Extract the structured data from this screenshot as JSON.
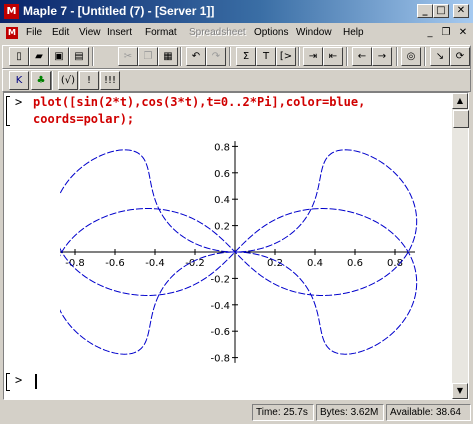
{
  "window": {
    "app_icon": "maple-leaf-icon",
    "title": "Maple 7 - [Untitled (7) - [Server 1]]",
    "controls": {
      "minimize": "_",
      "maximize": "□",
      "close": "✕"
    }
  },
  "menubar": {
    "items": [
      {
        "label": "File"
      },
      {
        "label": "Edit"
      },
      {
        "label": "View"
      },
      {
        "label": "Insert"
      },
      {
        "label": "Format"
      },
      {
        "label": "Spreadsheet",
        "disabled": true
      },
      {
        "label": "Options"
      },
      {
        "label": "Window"
      },
      {
        "label": "Help"
      }
    ],
    "doc_controls": {
      "minimize": "_",
      "restore": "❐",
      "close": "✕"
    }
  },
  "toolbar": {
    "buttons": [
      {
        "icon": "new-document-icon",
        "glyph": "▯"
      },
      {
        "icon": "open-folder-icon",
        "glyph": "▰"
      },
      {
        "icon": "save-icon",
        "glyph": "▣"
      },
      {
        "icon": "print-icon",
        "glyph": "▤"
      },
      {
        "icon": "cut-icon",
        "glyph": "✂",
        "disabled": true
      },
      {
        "icon": "copy-icon",
        "glyph": "❐",
        "disabled": true
      },
      {
        "icon": "paste-icon",
        "glyph": "▦"
      },
      {
        "icon": "undo-icon",
        "glyph": "↶"
      },
      {
        "icon": "redo-icon",
        "glyph": "↷",
        "disabled": true
      },
      {
        "icon": "sigma-icon",
        "glyph": "Σ"
      },
      {
        "icon": "text-mode-icon",
        "glyph": "T"
      },
      {
        "icon": "insert-prompt-icon",
        "glyph": "[>"
      },
      {
        "icon": "indent-icon",
        "glyph": "⇥"
      },
      {
        "icon": "outdent-icon",
        "glyph": "⇤"
      },
      {
        "icon": "back-icon",
        "glyph": "←"
      },
      {
        "icon": "forward-icon",
        "glyph": "→"
      },
      {
        "icon": "stop-icon",
        "glyph": "◎"
      },
      {
        "icon": "zoom-icon",
        "glyph": "↘"
      },
      {
        "icon": "restart-icon",
        "glyph": "⟳"
      }
    ]
  },
  "context_toolbar": {
    "buttons": [
      {
        "icon": "maple-input-icon",
        "glyph": "K"
      },
      {
        "icon": "leaf-icon",
        "glyph": "♣"
      },
      {
        "icon": "expression-icon",
        "glyph": "(√)"
      },
      {
        "icon": "execute-icon",
        "glyph": "!"
      },
      {
        "icon": "execute-all-icon",
        "glyph": "!!!"
      }
    ]
  },
  "worksheet": {
    "prompt": ">",
    "command_line1": "plot([sin(2*t),cos(3*t),t=0..2*Pi],color=blue,",
    "command_line2": "coords=polar);",
    "empty_prompt": ">"
  },
  "chart_data": {
    "type": "line",
    "title": "",
    "xlabel": "",
    "ylabel": "",
    "coords": "polar",
    "curve": {
      "r": "sin(2*t)",
      "theta": "cos(3*t)",
      "t_range": [
        0,
        6.283185
      ]
    },
    "color": "#0000cc",
    "xlim": [
      -0.9,
      0.9
    ],
    "ylim": [
      -0.84,
      0.84
    ],
    "x_ticks": [
      "-0.8",
      "-0.6",
      "-0.4",
      "-0.2",
      "0.2",
      "0.4",
      "0.6",
      "0.8"
    ],
    "y_ticks": [
      "0.8",
      "0.6",
      "0.4",
      "0.2",
      "-0.2",
      "-0.4",
      "-0.6",
      "-0.8"
    ],
    "x_tick_values": [
      -0.8,
      -0.6,
      -0.4,
      -0.2,
      0.2,
      0.4,
      0.6,
      0.8
    ],
    "y_tick_values": [
      0.8,
      0.6,
      0.4,
      0.2,
      -0.2,
      -0.4,
      -0.6,
      -0.8
    ]
  },
  "statusbar": {
    "time": "Time: 25.7s",
    "bytes": "Bytes: 3.62M",
    "available": "Available: 38.64"
  }
}
